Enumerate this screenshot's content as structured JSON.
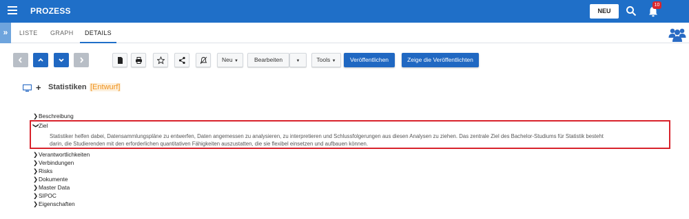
{
  "app": {
    "title": "PROZESS",
    "new_button": "NEU",
    "notification_count": "10"
  },
  "tabs": [
    {
      "label": "LISTE",
      "active": false
    },
    {
      "label": "GRAPH",
      "active": false
    },
    {
      "label": "DETAILS",
      "active": true
    }
  ],
  "toolbar": {
    "new_dropdown": "Neu",
    "edit_dropdown": "Bearbeiten",
    "tools_dropdown": "Tools",
    "publish_button": "Veröffentlichen",
    "show_published_button": "Zeige die Veröffentlichten"
  },
  "document": {
    "title": "Statistiken",
    "status": "[Entwurf]"
  },
  "sections": [
    {
      "label": "Beschreibung",
      "expanded": false
    },
    {
      "label": "Ziel",
      "expanded": true,
      "text_line1": "Statistiker helfen dabei, Datensammlungspläne zu entwerfen, Daten angemessen zu analysieren, zu interpretieren und Schlussfolgerungen aus diesen Analysen zu ziehen. Das zentrale Ziel des Bachelor-Studiums für Statistik besteht",
      "text_line2": "darin, die Studierenden mit den erforderlichen quantitativen Fähigkeiten auszustatten, die sie flexibel einsetzen und aufbauen können."
    },
    {
      "label": "Verantwortlichkeiten",
      "expanded": false
    },
    {
      "label": "Verbindungen",
      "expanded": false
    },
    {
      "label": "Risks",
      "expanded": false
    },
    {
      "label": "Dokumente",
      "expanded": false
    },
    {
      "label": "Master Data",
      "expanded": false
    },
    {
      "label": "SIPOC",
      "expanded": false
    },
    {
      "label": "Eigenschaften",
      "expanded": false
    }
  ],
  "colors": {
    "brand": "#1f6fc8",
    "highlight": "#d8212a",
    "status": "#f0921e"
  }
}
